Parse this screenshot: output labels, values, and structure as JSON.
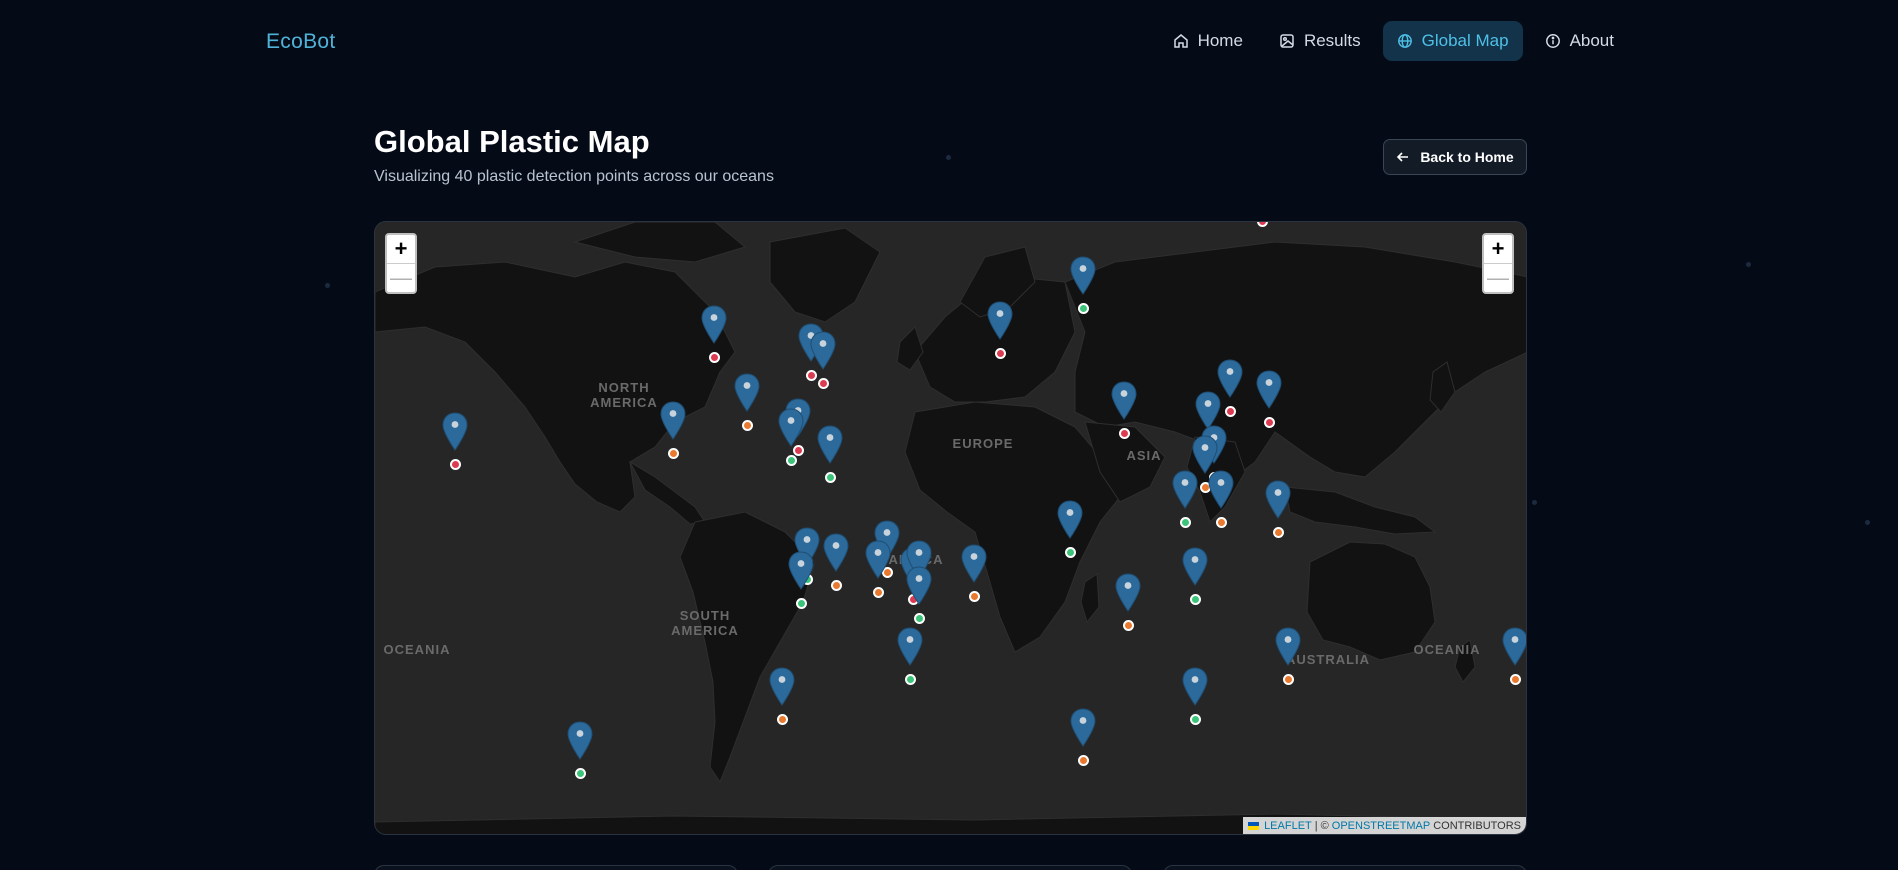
{
  "nav": {
    "logo": "EcoBot",
    "items": [
      {
        "label": "Home",
        "icon": "home-icon",
        "active": false
      },
      {
        "label": "Results",
        "icon": "image-icon",
        "active": false
      },
      {
        "label": "Global Map",
        "icon": "globe-icon",
        "active": true
      },
      {
        "label": "About",
        "icon": "info-icon",
        "active": false
      }
    ]
  },
  "header": {
    "title": "Global Plastic Map",
    "subtitle": "Visualizing 40 plastic detection points across our oceans",
    "back_label": "Back to Home"
  },
  "map": {
    "zoom_in": "+",
    "zoom_out": "—",
    "labels": {
      "north_america": "NORTH\nAMERICA",
      "south_america": "SOUTH\nAMERICA",
      "europe": "EUROPE",
      "africa": "AFRICA",
      "asia": "ASIA",
      "australia": "AUSTRALIA",
      "oceania_left": "OCEANIA",
      "oceania_right": "OCEANIA"
    },
    "attribution": {
      "leaflet": "Leaflet",
      "sep": "| ©",
      "osm": "OpenStreetMap",
      "contributors": "contributors"
    },
    "severity_colors": {
      "high": "#dc3c52",
      "medium": "#e8792e",
      "low": "#3cc47a"
    },
    "markers": [
      {
        "lat": 44,
        "lon": -74,
        "severity": "high"
      },
      {
        "lat": 40,
        "lon": -44,
        "severity": "high"
      },
      {
        "lat": 38,
        "lon": -40,
        "severity": "high"
      },
      {
        "lat": 27,
        "lon": -64,
        "severity": "medium"
      },
      {
        "lat": 20,
        "lon": -48,
        "severity": "high"
      },
      {
        "lat": 17,
        "lon": -50,
        "severity": "low"
      },
      {
        "lat": 19,
        "lon": -87,
        "severity": "medium"
      },
      {
        "lat": 12,
        "lon": -38,
        "severity": "low"
      },
      {
        "lat": 16,
        "lon": -155,
        "severity": "high"
      },
      {
        "lat": 45,
        "lon": 15,
        "severity": "high"
      },
      {
        "lat": 54,
        "lon": 41,
        "severity": "low"
      },
      {
        "lat": 67,
        "lon": 97,
        "severity": "high"
      },
      {
        "lat": 31,
        "lon": 87,
        "severity": "high"
      },
      {
        "lat": 28,
        "lon": 99,
        "severity": "high"
      },
      {
        "lat": 25,
        "lon": 54,
        "severity": "high"
      },
      {
        "lat": 22,
        "lon": 80,
        "severity": "low"
      },
      {
        "lat": 12,
        "lon": 82,
        "severity": "high"
      },
      {
        "lat": 9,
        "lon": 79,
        "severity": "medium"
      },
      {
        "lat": -2,
        "lon": 73,
        "severity": "low"
      },
      {
        "lat": -2,
        "lon": 84,
        "severity": "medium"
      },
      {
        "lat": -5,
        "lon": 102,
        "severity": "medium"
      },
      {
        "lat": -11,
        "lon": 37,
        "severity": "low"
      },
      {
        "lat": -25,
        "lon": 76,
        "severity": "low"
      },
      {
        "lat": -32,
        "lon": 55,
        "severity": "medium"
      },
      {
        "lat": -19,
        "lon": -45,
        "severity": "low"
      },
      {
        "lat": -21,
        "lon": -36,
        "severity": "medium"
      },
      {
        "lat": -17,
        "lon": -20,
        "severity": "medium"
      },
      {
        "lat": -23,
        "lon": -23,
        "severity": "medium"
      },
      {
        "lat": -25,
        "lon": -12,
        "severity": "high"
      },
      {
        "lat": -23,
        "lon": -10,
        "severity": "low"
      },
      {
        "lat": -30,
        "lon": -10,
        "severity": "low"
      },
      {
        "lat": -24,
        "lon": 7,
        "severity": "medium"
      },
      {
        "lat": -26,
        "lon": -47,
        "severity": "low"
      },
      {
        "lat": -45,
        "lon": -13,
        "severity": "low"
      },
      {
        "lat": -53,
        "lon": -53,
        "severity": "medium"
      },
      {
        "lat": -62,
        "lon": -116,
        "severity": "low"
      },
      {
        "lat": -53,
        "lon": 76,
        "severity": "low"
      },
      {
        "lat": -60,
        "lon": 41,
        "severity": "medium"
      },
      {
        "lat": -45,
        "lon": 105,
        "severity": "medium"
      },
      {
        "lat": -45,
        "lon": 176,
        "severity": "medium"
      }
    ]
  }
}
